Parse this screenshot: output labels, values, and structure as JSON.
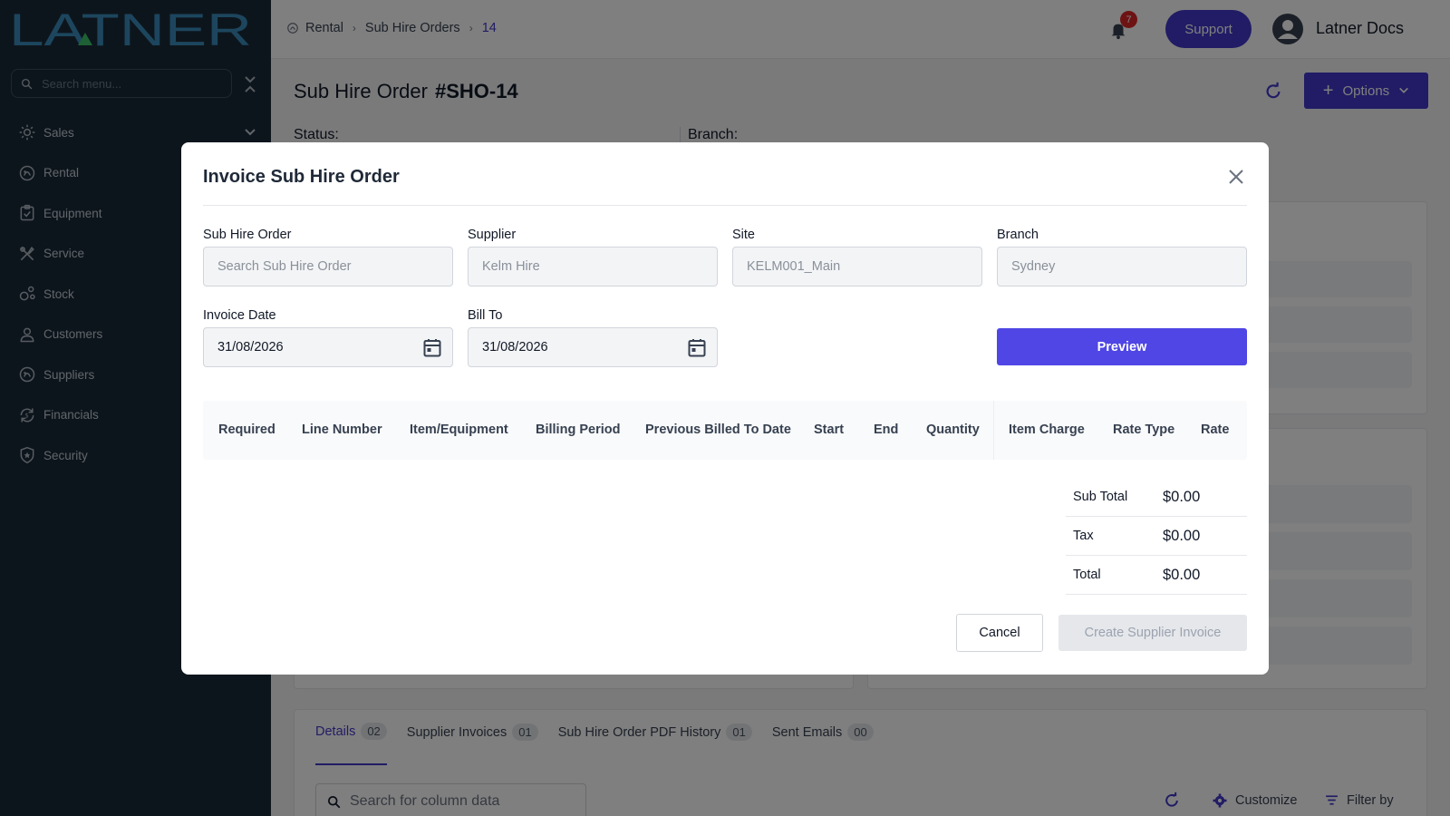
{
  "app": {
    "logo_text": "LATNER"
  },
  "sidebar": {
    "search_placeholder": "Search menu...",
    "items": [
      {
        "label": "Sales",
        "icon": "sales-icon"
      },
      {
        "label": "Rental",
        "icon": "rental-icon"
      },
      {
        "label": "Equipment",
        "icon": "equipment-icon"
      },
      {
        "label": "Service",
        "icon": "service-icon"
      },
      {
        "label": "Stock",
        "icon": "stock-icon"
      },
      {
        "label": "Customers",
        "icon": "customers-icon"
      },
      {
        "label": "Suppliers",
        "icon": "suppliers-icon"
      },
      {
        "label": "Financials",
        "icon": "financials-icon"
      },
      {
        "label": "Security",
        "icon": "security-icon"
      }
    ]
  },
  "header": {
    "breadcrumb": [
      "Rental",
      "Sub Hire Orders",
      "14"
    ],
    "notification_count": "7",
    "support_label": "Support",
    "user_name": "Latner Docs"
  },
  "page": {
    "title": "Sub Hire Order",
    "order_number": "#SHO-14",
    "options_label": "Options",
    "status_label": "Status:",
    "branch_label": "Branch:"
  },
  "tabs": [
    {
      "label": "Details",
      "count": "02"
    },
    {
      "label": "Supplier Invoices",
      "count": "01"
    },
    {
      "label": "Sub Hire Order PDF History",
      "count": "01"
    },
    {
      "label": "Sent Emails",
      "count": "00"
    }
  ],
  "toolbar": {
    "search_placeholder": "Search for column data",
    "customize_label": "Customize",
    "filter_label": "Filter by"
  },
  "modal": {
    "title": "Invoice Sub Hire Order",
    "fields": {
      "sub_hire_order": {
        "label": "Sub Hire Order",
        "placeholder": "Search Sub Hire Order"
      },
      "supplier": {
        "label": "Supplier",
        "value": "Kelm Hire"
      },
      "site": {
        "label": "Site",
        "value": "KELM001_Main"
      },
      "branch": {
        "label": "Branch",
        "value": "Sydney"
      },
      "invoice_date": {
        "label": "Invoice Date",
        "value": "31/08/2026"
      },
      "bill_to": {
        "label": "Bill To",
        "value": "31/08/2026"
      }
    },
    "preview_label": "Preview",
    "table_headers": [
      "Required",
      "Line Number",
      "Item/Equipment",
      "Billing Period",
      "Previous Billed To Date",
      "Start",
      "End",
      "Quantity",
      "Item Charge",
      "Rate Type",
      "Rate"
    ],
    "totals": [
      {
        "label": "Sub Total",
        "value": "$0.00"
      },
      {
        "label": "Tax",
        "value": "$0.00"
      },
      {
        "label": "Total",
        "value": "$0.00"
      }
    ],
    "cancel_label": "Cancel",
    "create_label": "Create Supplier Invoice"
  },
  "colors": {
    "sidebar_bg": "#1b2a38",
    "accent": "#4338ca",
    "primary_button": "#4f46e5",
    "logo": "#3b8dbd",
    "logo_accent": "#3cc26a",
    "badge": "#dc2626"
  }
}
